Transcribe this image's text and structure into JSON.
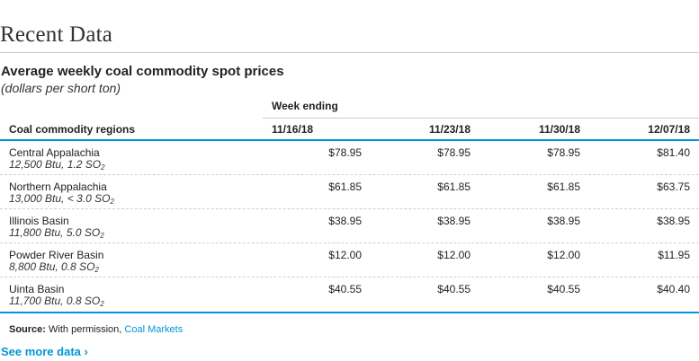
{
  "page": {
    "section_title": "Recent Data"
  },
  "table": {
    "title": "Average weekly coal commodity spot prices",
    "subtitle": "(dollars per short ton)",
    "week_ending_label": "Week ending",
    "region_header": "Coal commodity regions",
    "dates": [
      "11/16/18",
      "11/23/18",
      "11/30/18",
      "12/07/18"
    ],
    "rows": [
      {
        "name": "Central Appalachia",
        "spec_prefix": "12,500 Btu, 1.2 SO",
        "spec_sub": "2",
        "prices": [
          "$78.95",
          "$78.95",
          "$78.95",
          "$81.40"
        ]
      },
      {
        "name": "Northern Appalachia",
        "spec_prefix": "13,000 Btu, < 3.0 SO",
        "spec_sub": "2",
        "prices": [
          "$61.85",
          "$61.85",
          "$61.85",
          "$63.75"
        ]
      },
      {
        "name": "Illinois Basin",
        "spec_prefix": "11,800 Btu, 5.0 SO",
        "spec_sub": "2",
        "prices": [
          "$38.95",
          "$38.95",
          "$38.95",
          "$38.95"
        ]
      },
      {
        "name": "Powder River Basin",
        "spec_prefix": "8,800 Btu, 0.8 SO",
        "spec_sub": "2",
        "prices": [
          "$12.00",
          "$12.00",
          "$12.00",
          "$11.95"
        ]
      },
      {
        "name": "Uinta Basin",
        "spec_prefix": "11,700 Btu, 0.8 SO",
        "spec_sub": "2",
        "prices": [
          "$40.55",
          "$40.55",
          "$40.55",
          "$40.40"
        ]
      }
    ]
  },
  "source": {
    "label": "Source:",
    "text": " With permission, ",
    "link_text": "Coal Markets"
  },
  "footer": {
    "see_more": "See more data ›"
  },
  "colors": {
    "accent": "#0096d7",
    "rule": "#cccccc",
    "text": "#222222"
  }
}
